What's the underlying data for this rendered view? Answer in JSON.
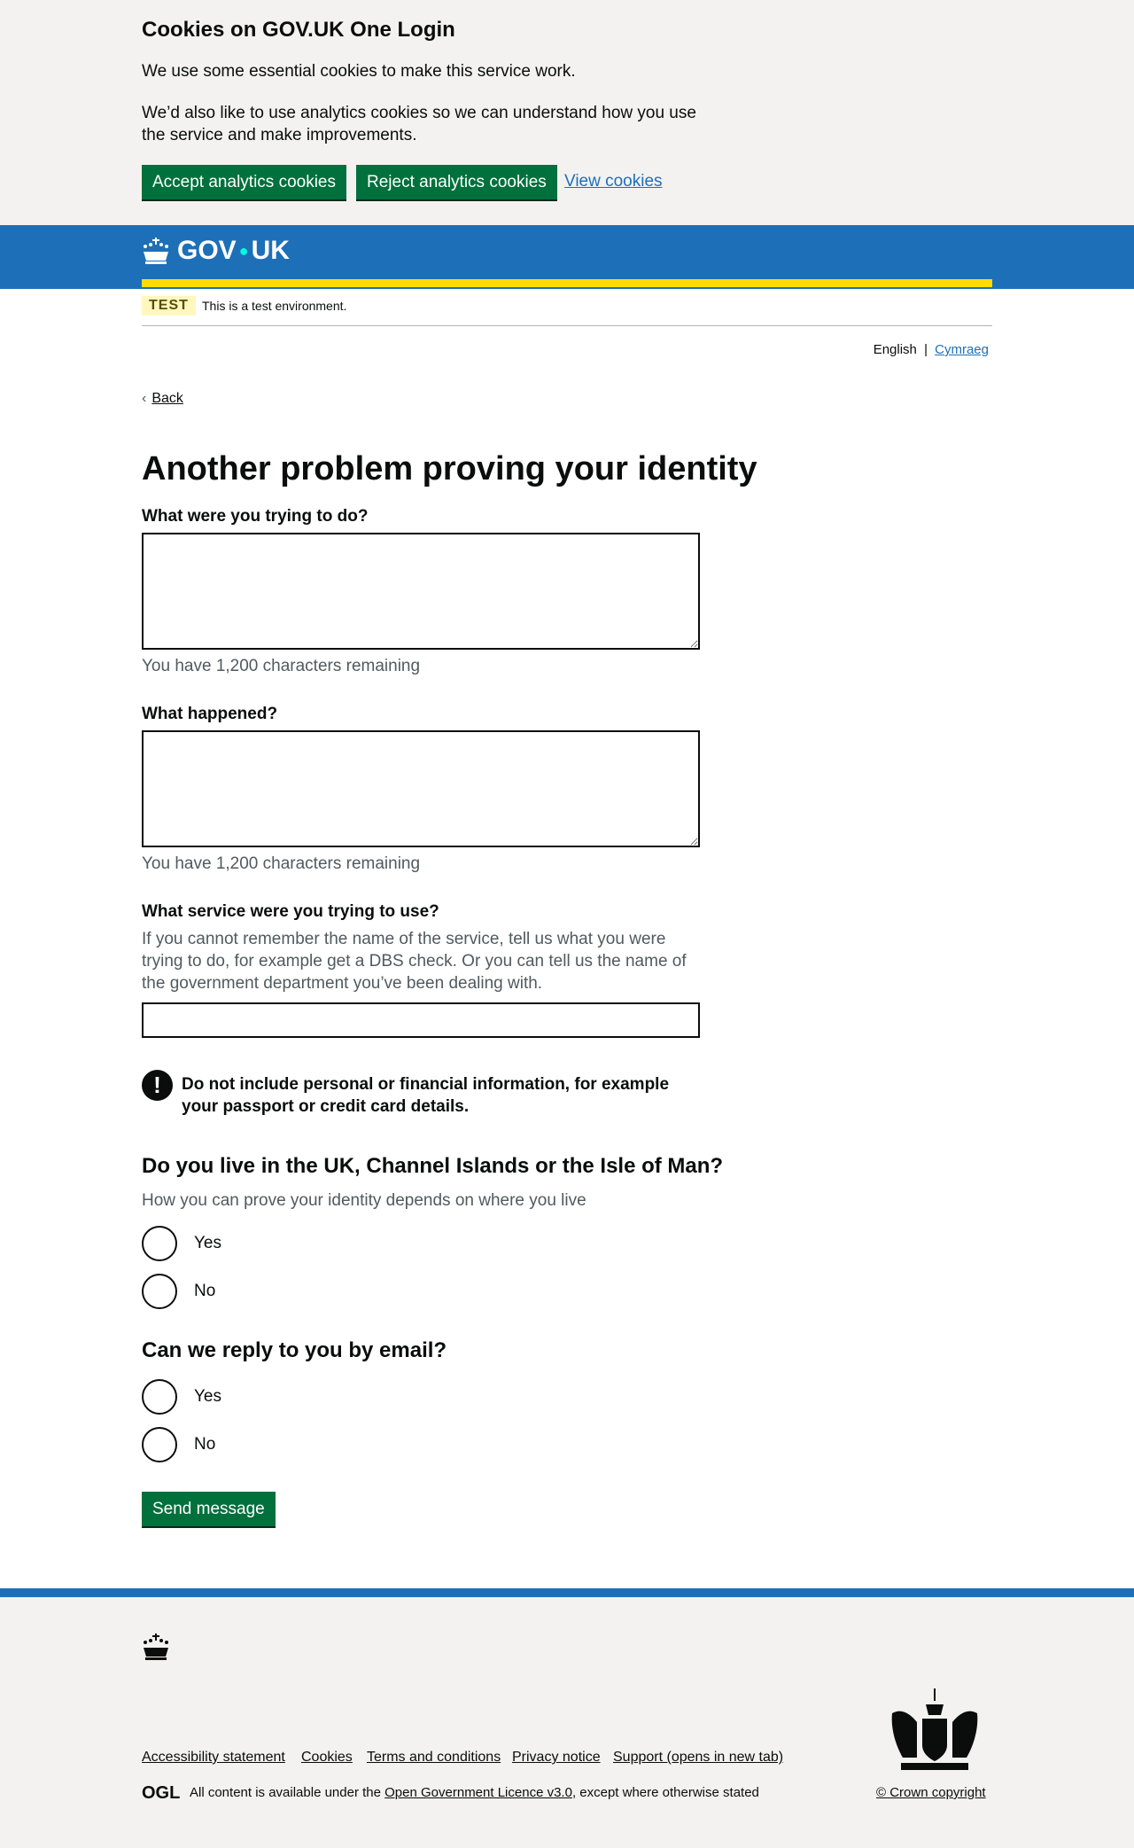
{
  "cookie_banner": {
    "title": "Cookies on GOV.UK One Login",
    "p1": "We use some essential cookies to make this service work.",
    "p2": "We’d also like to use analytics cookies so we can understand how you use the service and make improvements.",
    "accept": "Accept analytics cookies",
    "reject": "Reject analytics cookies",
    "view": "View cookies"
  },
  "header": {
    "logo": "GOV",
    "logo2": "UK"
  },
  "phase": {
    "tag": "TEST",
    "text": "This is a test environment."
  },
  "language": {
    "english": "English",
    "sep": "|",
    "welsh": "Cymraeg"
  },
  "back": "Back",
  "page_title": "Another problem proving your identity",
  "q1": {
    "label": "What were you trying to do?",
    "value": "",
    "count": "You have 1,200 characters remaining"
  },
  "q2": {
    "label": "What happened?",
    "value": "",
    "count": "You have 1,200 characters remaining"
  },
  "q3": {
    "label": "What service were you trying to use?",
    "hint": "If you cannot remember the name of the service, tell us what you were trying to do, for example get a DBS check. Or you can tell us the name of the government department you’ve been dealing with.",
    "value": ""
  },
  "warning": {
    "icon": "!",
    "text": "Do not include personal or financial information, for example your passport or credit card details."
  },
  "q4": {
    "title": "Do you live in the UK, Channel Islands or the Isle of Man?",
    "hint": "How you can prove your identity depends on where you live",
    "options": [
      "Yes",
      "No"
    ]
  },
  "q5": {
    "title": "Can we reply to you by email?",
    "options": [
      "Yes",
      "No"
    ]
  },
  "submit": "Send message",
  "footer": {
    "links": [
      "Accessibility statement",
      "Cookies",
      "Terms and conditions",
      "Privacy notice",
      "Support (opens in new tab)"
    ],
    "ogl": "OGL",
    "licence_pre": "All content is available under the ",
    "licence_link": "Open Government Licence v3.0",
    "licence_post": ", except where otherwise stated",
    "copyright": "© Crown copyright"
  },
  "colors": {
    "brand": "#1d70b8",
    "button": "#00703c",
    "yellow": "#ffdd00"
  }
}
